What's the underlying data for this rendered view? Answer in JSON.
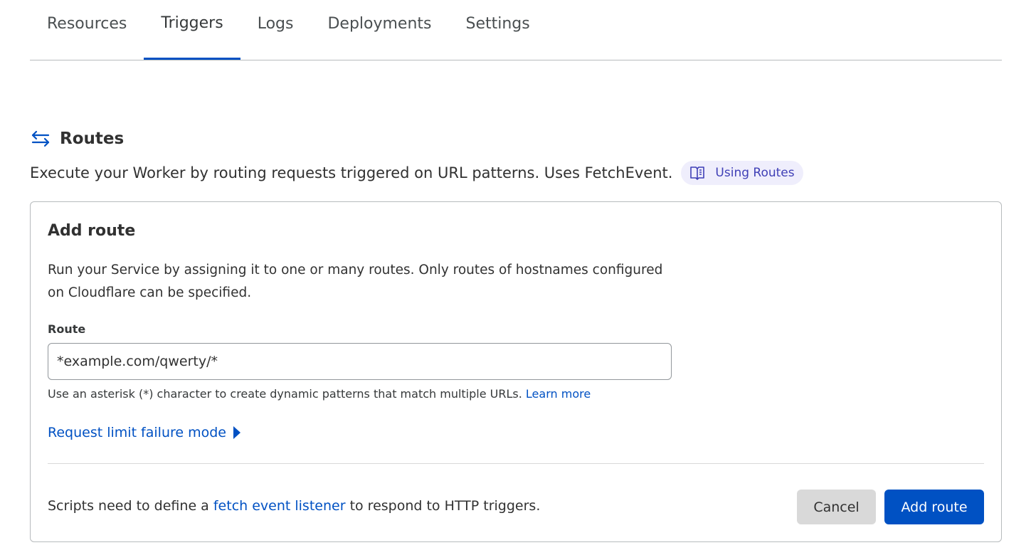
{
  "tabs": [
    {
      "label": "Resources"
    },
    {
      "label": "Triggers",
      "active": true
    },
    {
      "label": "Logs"
    },
    {
      "label": "Deployments"
    },
    {
      "label": "Settings"
    }
  ],
  "routes": {
    "title": "Routes",
    "icon": "arrows-left-right-icon",
    "description": "Execute your Worker by routing requests triggered on URL patterns. Uses FetchEvent.",
    "doc_link": {
      "label": "Using Routes",
      "icon": "book-icon"
    }
  },
  "add_route": {
    "title": "Add route",
    "description": "Run your Service by assigning it to one or many routes. Only routes of hostnames configured on Cloudflare can be specified.",
    "field_label": "Route",
    "field_value": "*example.com/qwerty/*",
    "helper_text": "Use an asterisk (*) character to create dynamic patterns that match multiple URLs.",
    "helper_link": "Learn more",
    "expander_label": "Request limit failure mode",
    "footer_prefix": "Scripts need to define a",
    "footer_link": "fetch event listener",
    "footer_suffix": "to respond to HTTP triggers.",
    "cancel_label": "Cancel",
    "submit_label": "Add route"
  },
  "colors": {
    "accent": "#0051c3",
    "pill_bg": "#efeefc",
    "pill_text": "#3f3fb6"
  }
}
